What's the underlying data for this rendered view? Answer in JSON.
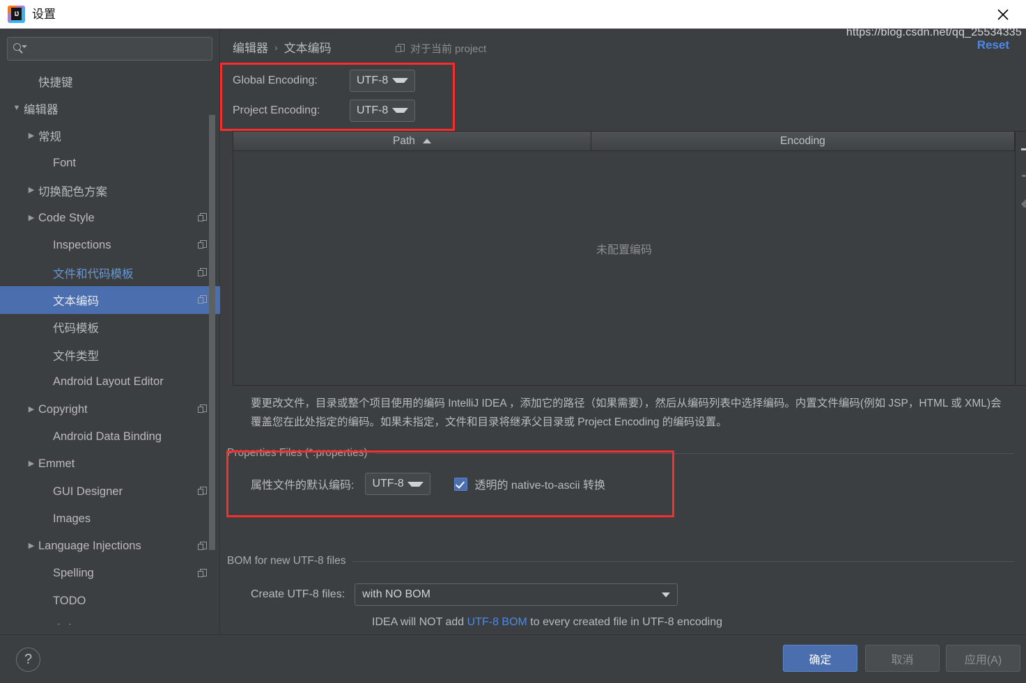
{
  "window": {
    "title": "设置",
    "logo_text": "IJ",
    "close_label": "×"
  },
  "sidebar": {
    "search": {
      "value": "",
      "placeholder": ""
    },
    "items": [
      {
        "label": "快捷键",
        "indent": 1,
        "arrow": "",
        "cjk": true,
        "copy": false,
        "selected": false,
        "link": false
      },
      {
        "label": "编辑器",
        "indent": 0,
        "arrow": "▼",
        "cjk": true,
        "copy": false,
        "selected": false,
        "link": false
      },
      {
        "label": "常规",
        "indent": 1,
        "arrow": "▶",
        "cjk": true,
        "copy": false,
        "selected": false,
        "link": false
      },
      {
        "label": "Font",
        "indent": 2,
        "arrow": "",
        "cjk": false,
        "copy": false,
        "selected": false,
        "link": false
      },
      {
        "label": "切换配色方案",
        "indent": 1,
        "arrow": "▶",
        "cjk": true,
        "copy": false,
        "selected": false,
        "link": false
      },
      {
        "label": "Code Style",
        "indent": 1,
        "arrow": "▶",
        "cjk": false,
        "copy": true,
        "selected": false,
        "link": false
      },
      {
        "label": "Inspections",
        "indent": 2,
        "arrow": "",
        "cjk": false,
        "copy": true,
        "selected": false,
        "link": false
      },
      {
        "label": "文件和代码模板",
        "indent": 2,
        "arrow": "",
        "cjk": true,
        "copy": true,
        "selected": false,
        "link": true
      },
      {
        "label": "文本编码",
        "indent": 2,
        "arrow": "",
        "cjk": true,
        "copy": true,
        "selected": true,
        "link": false
      },
      {
        "label": "代码模板",
        "indent": 2,
        "arrow": "",
        "cjk": true,
        "copy": false,
        "selected": false,
        "link": false
      },
      {
        "label": "文件类型",
        "indent": 2,
        "arrow": "",
        "cjk": true,
        "copy": false,
        "selected": false,
        "link": false
      },
      {
        "label": "Android Layout Editor",
        "indent": 2,
        "arrow": "",
        "cjk": false,
        "copy": false,
        "selected": false,
        "link": false
      },
      {
        "label": "Copyright",
        "indent": 1,
        "arrow": "▶",
        "cjk": false,
        "copy": true,
        "selected": false,
        "link": false
      },
      {
        "label": "Android Data Binding",
        "indent": 2,
        "arrow": "",
        "cjk": false,
        "copy": false,
        "selected": false,
        "link": false
      },
      {
        "label": "Emmet",
        "indent": 1,
        "arrow": "▶",
        "cjk": false,
        "copy": false,
        "selected": false,
        "link": false
      },
      {
        "label": "GUI Designer",
        "indent": 2,
        "arrow": "",
        "cjk": false,
        "copy": true,
        "selected": false,
        "link": false
      },
      {
        "label": "Images",
        "indent": 2,
        "arrow": "",
        "cjk": false,
        "copy": false,
        "selected": false,
        "link": false
      },
      {
        "label": "Language Injections",
        "indent": 1,
        "arrow": "▶",
        "cjk": false,
        "copy": true,
        "selected": false,
        "link": false
      },
      {
        "label": "Spelling",
        "indent": 2,
        "arrow": "",
        "cjk": false,
        "copy": true,
        "selected": false,
        "link": false
      },
      {
        "label": "TODO",
        "indent": 2,
        "arrow": "",
        "cjk": false,
        "copy": false,
        "selected": false,
        "link": false
      },
      {
        "label": "意向",
        "indent": 2,
        "arrow": "",
        "cjk": true,
        "copy": false,
        "selected": false,
        "link": false
      }
    ]
  },
  "main": {
    "breadcrumb": {
      "parent": "编辑器",
      "separator": "›",
      "current": "文本编码"
    },
    "scope_note": "对于当前 project",
    "reset_label": "Reset",
    "encodings": [
      {
        "label": "Global Encoding:",
        "value": "UTF-8"
      },
      {
        "label": "Project Encoding:",
        "value": "UTF-8"
      }
    ],
    "table": {
      "columns": [
        "Path",
        "Encoding"
      ],
      "sort_column": "Path",
      "sort_direction": "ascending",
      "rows": [],
      "empty_message": "未配置编码",
      "toolbar": {
        "add": "+",
        "remove": "−",
        "edit": "edit"
      }
    },
    "description": "要更改文件，目录或整个项目使用的编码 IntelliJ IDEA ，添加它的路径（如果需要），然后从编码列表中选择编码。内置文件编码(例如 JSP，HTML 或 XML)会覆盖您在此处指定的编码。如果未指定，文件和目录将继承父目录或 Project Encoding 的编码设置。",
    "properties_group": {
      "title": "Properties Files (*.properties)",
      "encoding_label": "属性文件的默认编码:",
      "encoding_value": "UTF-8",
      "checkbox_label": "透明的 native-to-ascii 转换",
      "checkbox_checked": true
    },
    "bom_group": {
      "title": "BOM for new UTF-8 files",
      "create_label": "Create UTF-8 files:",
      "create_value": "with NO BOM",
      "note_prefix": "IDEA will NOT add ",
      "note_link": "UTF-8 BOM",
      "note_suffix": " to every created file in UTF-8 encoding"
    }
  },
  "footer": {
    "help_label": "?",
    "ok_label": "确定",
    "cancel_label": "取消",
    "apply_label": "应用(A)"
  },
  "watermark": "https://blog.csdn.net/qq_25534335",
  "colors": {
    "accent_selection": "#4b6eaf",
    "link": "#4d89e8",
    "annotation": "#fb2c2c",
    "panel_bg": "#3c3f41",
    "text": "#b9bcbe"
  }
}
